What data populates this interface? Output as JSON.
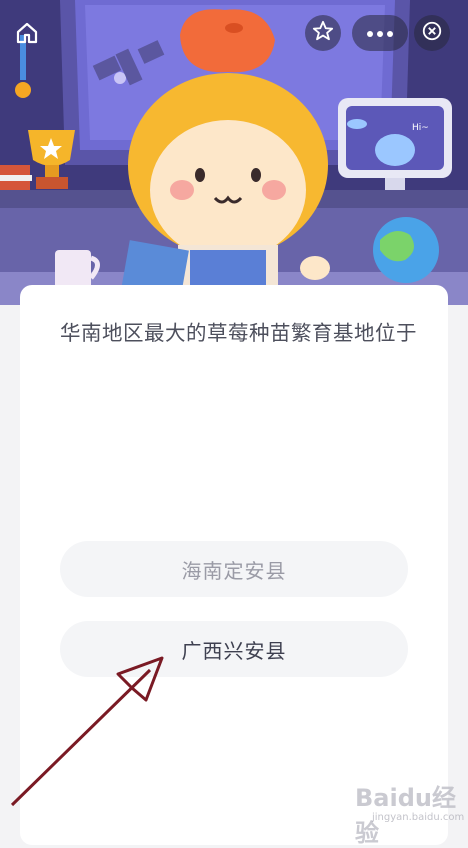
{
  "question": {
    "text": "华南地区最大的草莓种苗繁育基地位于"
  },
  "options": [
    {
      "label": "海南定安县"
    },
    {
      "label": "广西兴安县"
    }
  ],
  "icons": {
    "home": "home-icon",
    "star": "star-icon",
    "more": "more-icon",
    "close": "close-icon"
  },
  "monitor_text": "Hi~",
  "watermark": {
    "brand": "Baidu经验",
    "url": "jingyan.baidu.com"
  },
  "colors": {
    "scene_bg": "#3b3575",
    "arrow": "#7a1a24",
    "option_bg": "#f4f5f7"
  }
}
